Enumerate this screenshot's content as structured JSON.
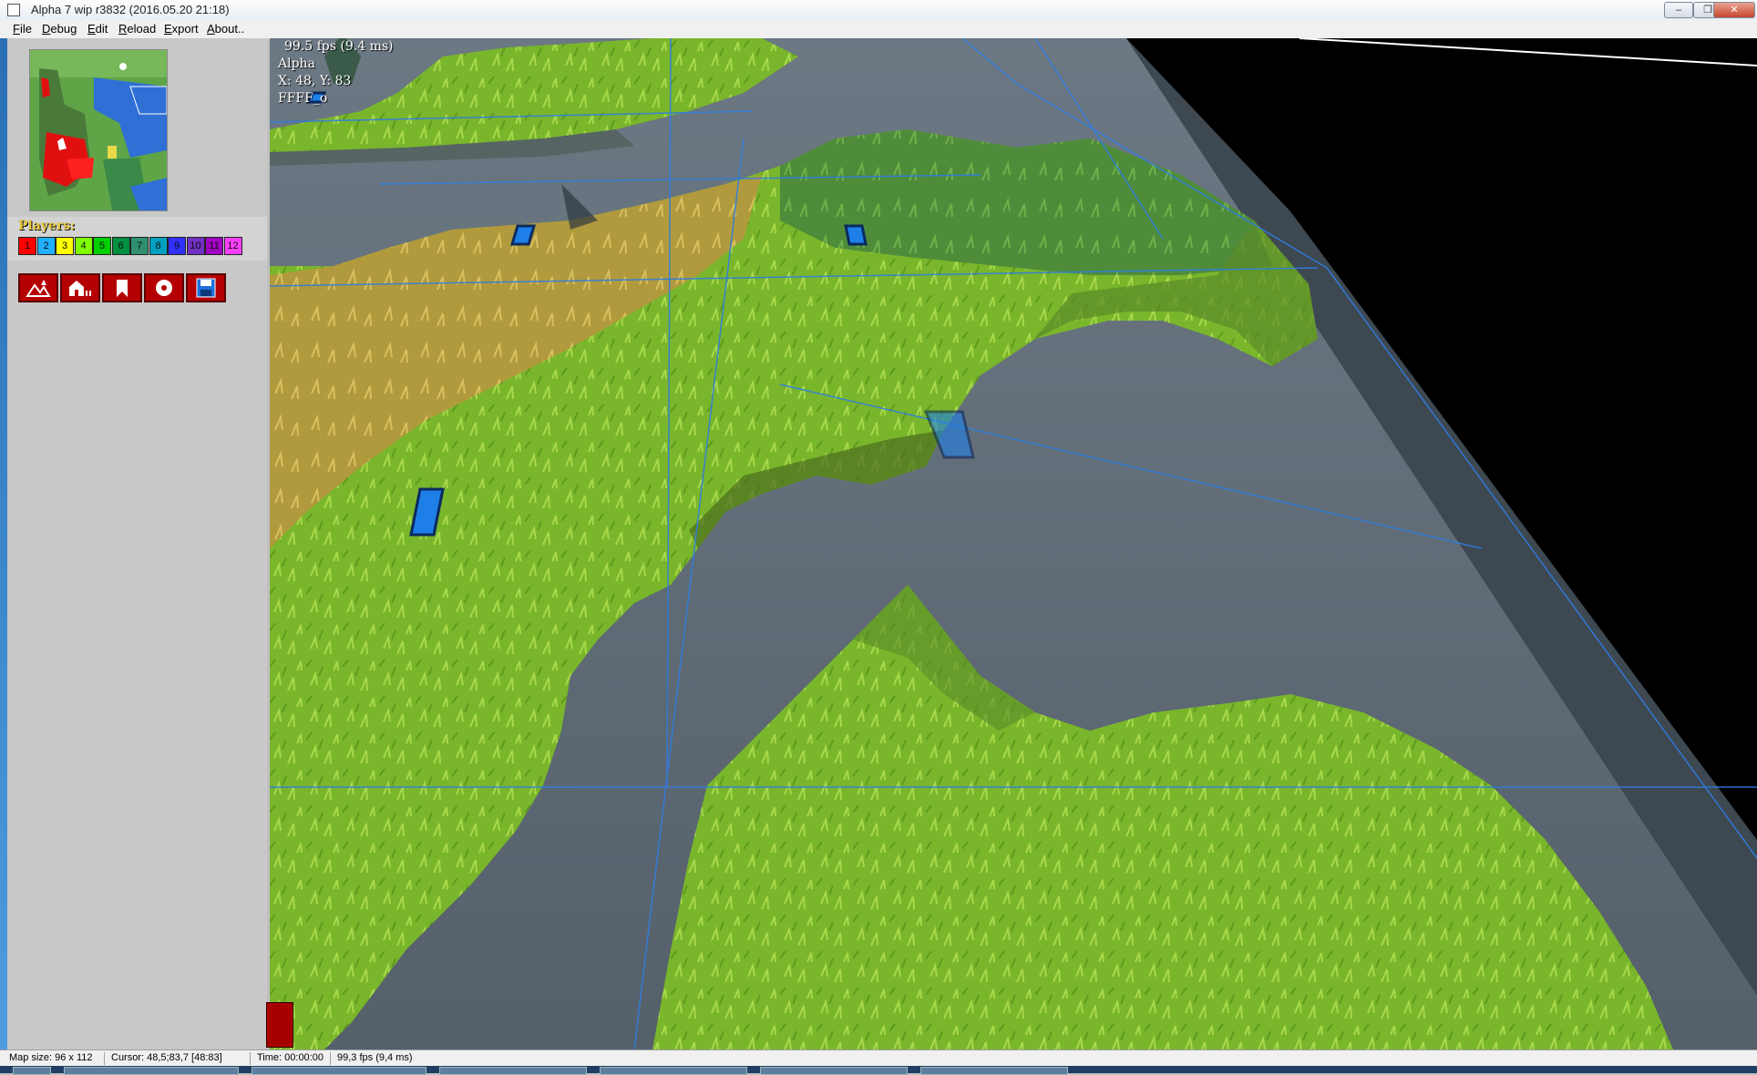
{
  "window": {
    "title": "Alpha 7 wip r3832 (2016.05.20 21:18)"
  },
  "menu": [
    "File",
    "Debug",
    "Edit",
    "Reload",
    "Export",
    "About.."
  ],
  "players": {
    "label": "Players:",
    "cells": [
      {
        "n": "1",
        "color": "#ff0000"
      },
      {
        "n": "2",
        "color": "#20b0ff"
      },
      {
        "n": "3",
        "color": "#ffff00"
      },
      {
        "n": "4",
        "color": "#80ff00"
      },
      {
        "n": "5",
        "color": "#00d000"
      },
      {
        "n": "6",
        "color": "#009040"
      },
      {
        "n": "7",
        "color": "#2f8f6f"
      },
      {
        "n": "8",
        "color": "#00a0c0"
      },
      {
        "n": "9",
        "color": "#3030ff"
      },
      {
        "n": "10",
        "color": "#7030c0"
      },
      {
        "n": "11",
        "color": "#a000c0"
      },
      {
        "n": "12",
        "color": "#ff40ff"
      }
    ]
  },
  "toolbar": {
    "buttons": [
      {
        "icon": "terrain-icon"
      },
      {
        "icon": "houses-icon"
      },
      {
        "icon": "flag-icon"
      },
      {
        "icon": "scripts-icon"
      },
      {
        "icon": "save-icon"
      }
    ]
  },
  "hud": {
    "fps": "99.5 fps (9.4 ms)",
    "name": "Alpha",
    "coords": "X: 48, Y: 83",
    "hex": "FFFF_o"
  },
  "status": {
    "map_size": "Map size: 96 x 112",
    "cursor": "Cursor: 48,5;83,7 [48:83]",
    "time": "Time: 00:00:00",
    "fps": "99,3 fps (9,4 ms)"
  },
  "colors": {
    "grass": "#7ab82a",
    "water": "#5e6a75",
    "panel": "#c8c8c8",
    "button_red": "#b40000",
    "grid": "#2f7de0"
  }
}
